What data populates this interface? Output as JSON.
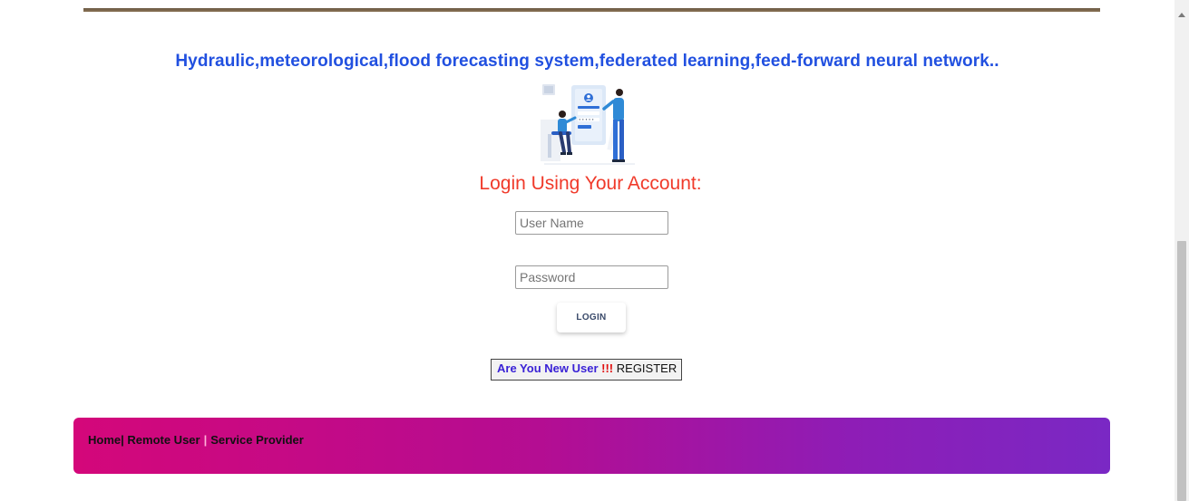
{
  "headline": "Hydraulic,meteorological,flood forecasting system,federated learning,feed-forward neural network..",
  "login": {
    "title": "Login Using Your Account:",
    "username_placeholder": "User Name",
    "password_placeholder": "Password",
    "button_label": "LOGIN"
  },
  "register": {
    "question": "Are You New User",
    "exclaim": "!!!",
    "link": "REGISTER"
  },
  "footer": {
    "links": [
      "Home",
      "Remote User",
      "Service Provider"
    ],
    "separator": "|"
  },
  "colors": {
    "headline": "#2150e0",
    "login_title": "#f03a2a",
    "footer_gradient_start": "#d4077a",
    "footer_gradient_end": "#7a28c4"
  }
}
